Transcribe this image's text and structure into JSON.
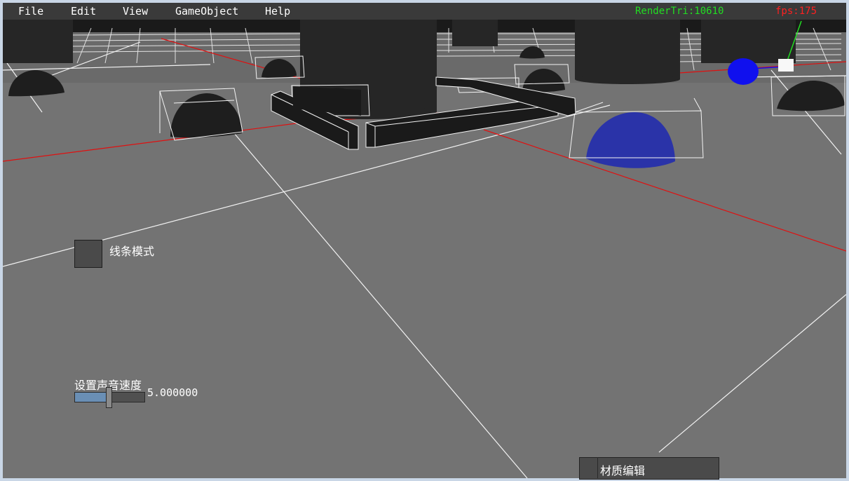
{
  "menubar": {
    "items": [
      {
        "label": "File"
      },
      {
        "label": "Edit"
      },
      {
        "label": "View"
      },
      {
        "label": "GameObject"
      },
      {
        "label": "Help"
      }
    ],
    "render_tri": "RenderTri:10610",
    "fps": "fps:175"
  },
  "controls": {
    "wireframe_checkbox": {
      "label": "线条模式",
      "checked": false
    },
    "sound_speed": {
      "label": "设置声音速度",
      "value": "5.000000",
      "fraction": 0.5
    },
    "material_button": {
      "label": "材质编辑"
    }
  },
  "colors": {
    "render_tri": "#22dd22",
    "fps": "#ff2020",
    "menubar_bg": "#3a3a3a",
    "viewport_bg": "#737373"
  }
}
